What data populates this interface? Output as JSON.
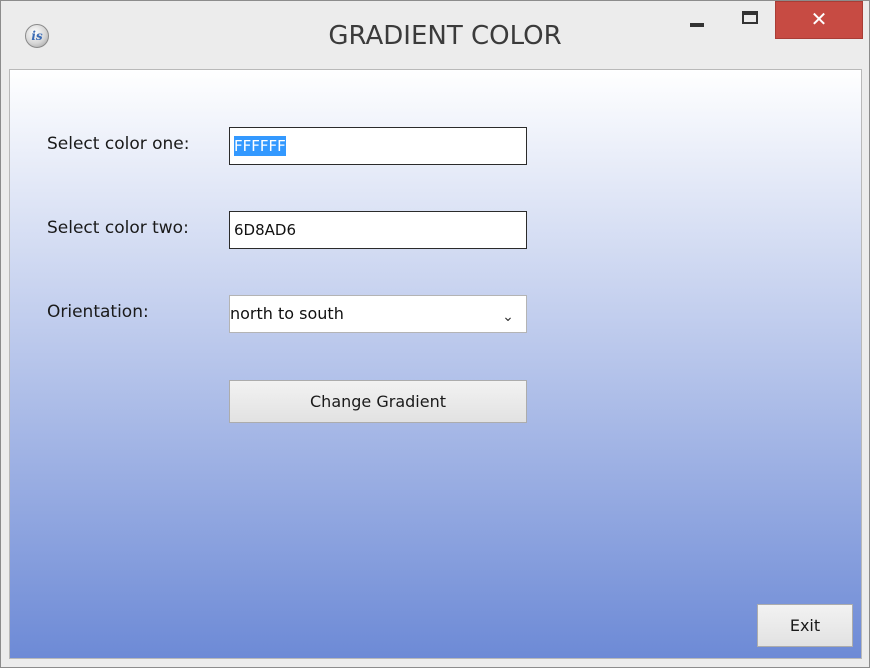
{
  "window": {
    "title": "GRADIENT COLOR",
    "app_icon_text": "is",
    "minimize_label": "",
    "maximize_label": "",
    "close_label": "✕"
  },
  "form": {
    "color_one_label": "Select color one:",
    "color_one_value": "FFFFFF",
    "color_two_label": "Select color two:",
    "color_two_value": "6D8AD6",
    "orientation_label": "Orientation:",
    "orientation_value": "north to south",
    "change_button_label": "Change Gradient",
    "exit_button_label": "Exit"
  },
  "colors": {
    "gradient_start": "#FFFFFF",
    "gradient_end": "#6D8AD6",
    "close_button": "#C74B43",
    "selection_highlight": "#3399FF"
  },
  "icons": {
    "app": "app-logo-icon",
    "minimize": "minimize-icon",
    "maximize": "maximize-icon",
    "close": "close-icon",
    "dropdown": "chevron-down-icon"
  }
}
